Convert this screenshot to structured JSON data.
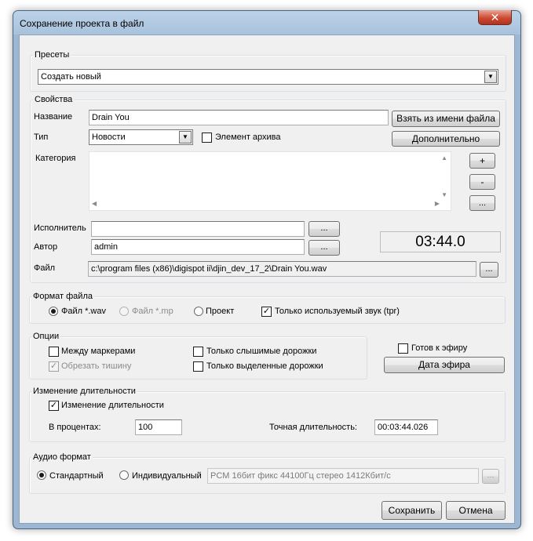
{
  "window": {
    "title": "Сохранение проекта в файл",
    "close_glyph": "✕"
  },
  "presets": {
    "group_label": "Пресеты",
    "selected": "Создать новый"
  },
  "properties": {
    "group_label": "Свойства",
    "name_label": "Название",
    "name_value": "Drain You",
    "take_from_filename_button": "Взять из имени файла",
    "type_label": "Тип",
    "type_selected": "Новости",
    "archive_item_label": "Элемент архива",
    "archive_item_checked": false,
    "advanced_button": "Дополнительно",
    "category_label": "Категория",
    "category_add_button": "+",
    "category_remove_button": "-",
    "category_more_button": "...",
    "performer_label": "Исполнитель",
    "performer_value": "",
    "performer_browse": "...",
    "author_label": "Автор",
    "author_value": "admin",
    "author_browse": "...",
    "duration": "03:44.0",
    "file_label": "Файл",
    "file_path": "c:\\program files (x86)\\digispot ii\\djin_dev_17_2\\Drain You.wav",
    "file_browse": "..."
  },
  "file_format": {
    "group_label": "Формат файла",
    "options": [
      "Файл *.wav",
      "Файл *.mp",
      "Проект"
    ],
    "selected_index": 0,
    "used_sound_only_label": "Только используемый звук (tpr)",
    "used_sound_only_checked": true
  },
  "options": {
    "group_label": "Опции",
    "between_markers": "Между маркерами",
    "trim_silence": "Обрезать тишину",
    "audible_tracks_only": "Только слышимые дорожки",
    "selected_tracks_only": "Только выделенные дорожки"
  },
  "air": {
    "ready_label": "Готов к эфиру",
    "air_date_button": "Дата эфира"
  },
  "duration_change": {
    "group_label": "Изменение длительности",
    "checkbox_label": "Изменение длительности",
    "checked": true,
    "percent_label": "В процентах:",
    "percent_value": "100",
    "exact_label": "Точная длительность:",
    "exact_value": "00:03:44.026"
  },
  "audio_format": {
    "group_label": "Аудио формат",
    "standard_label": "Стандартный",
    "custom_label": "Индивидуальный",
    "selected": "standard",
    "format_value": "PCM 16бит фикс 44100Гц стерео 1412Кбит/с",
    "browse": "..."
  },
  "footer": {
    "save_button": "Сохранить",
    "cancel_button": "Отмена"
  }
}
